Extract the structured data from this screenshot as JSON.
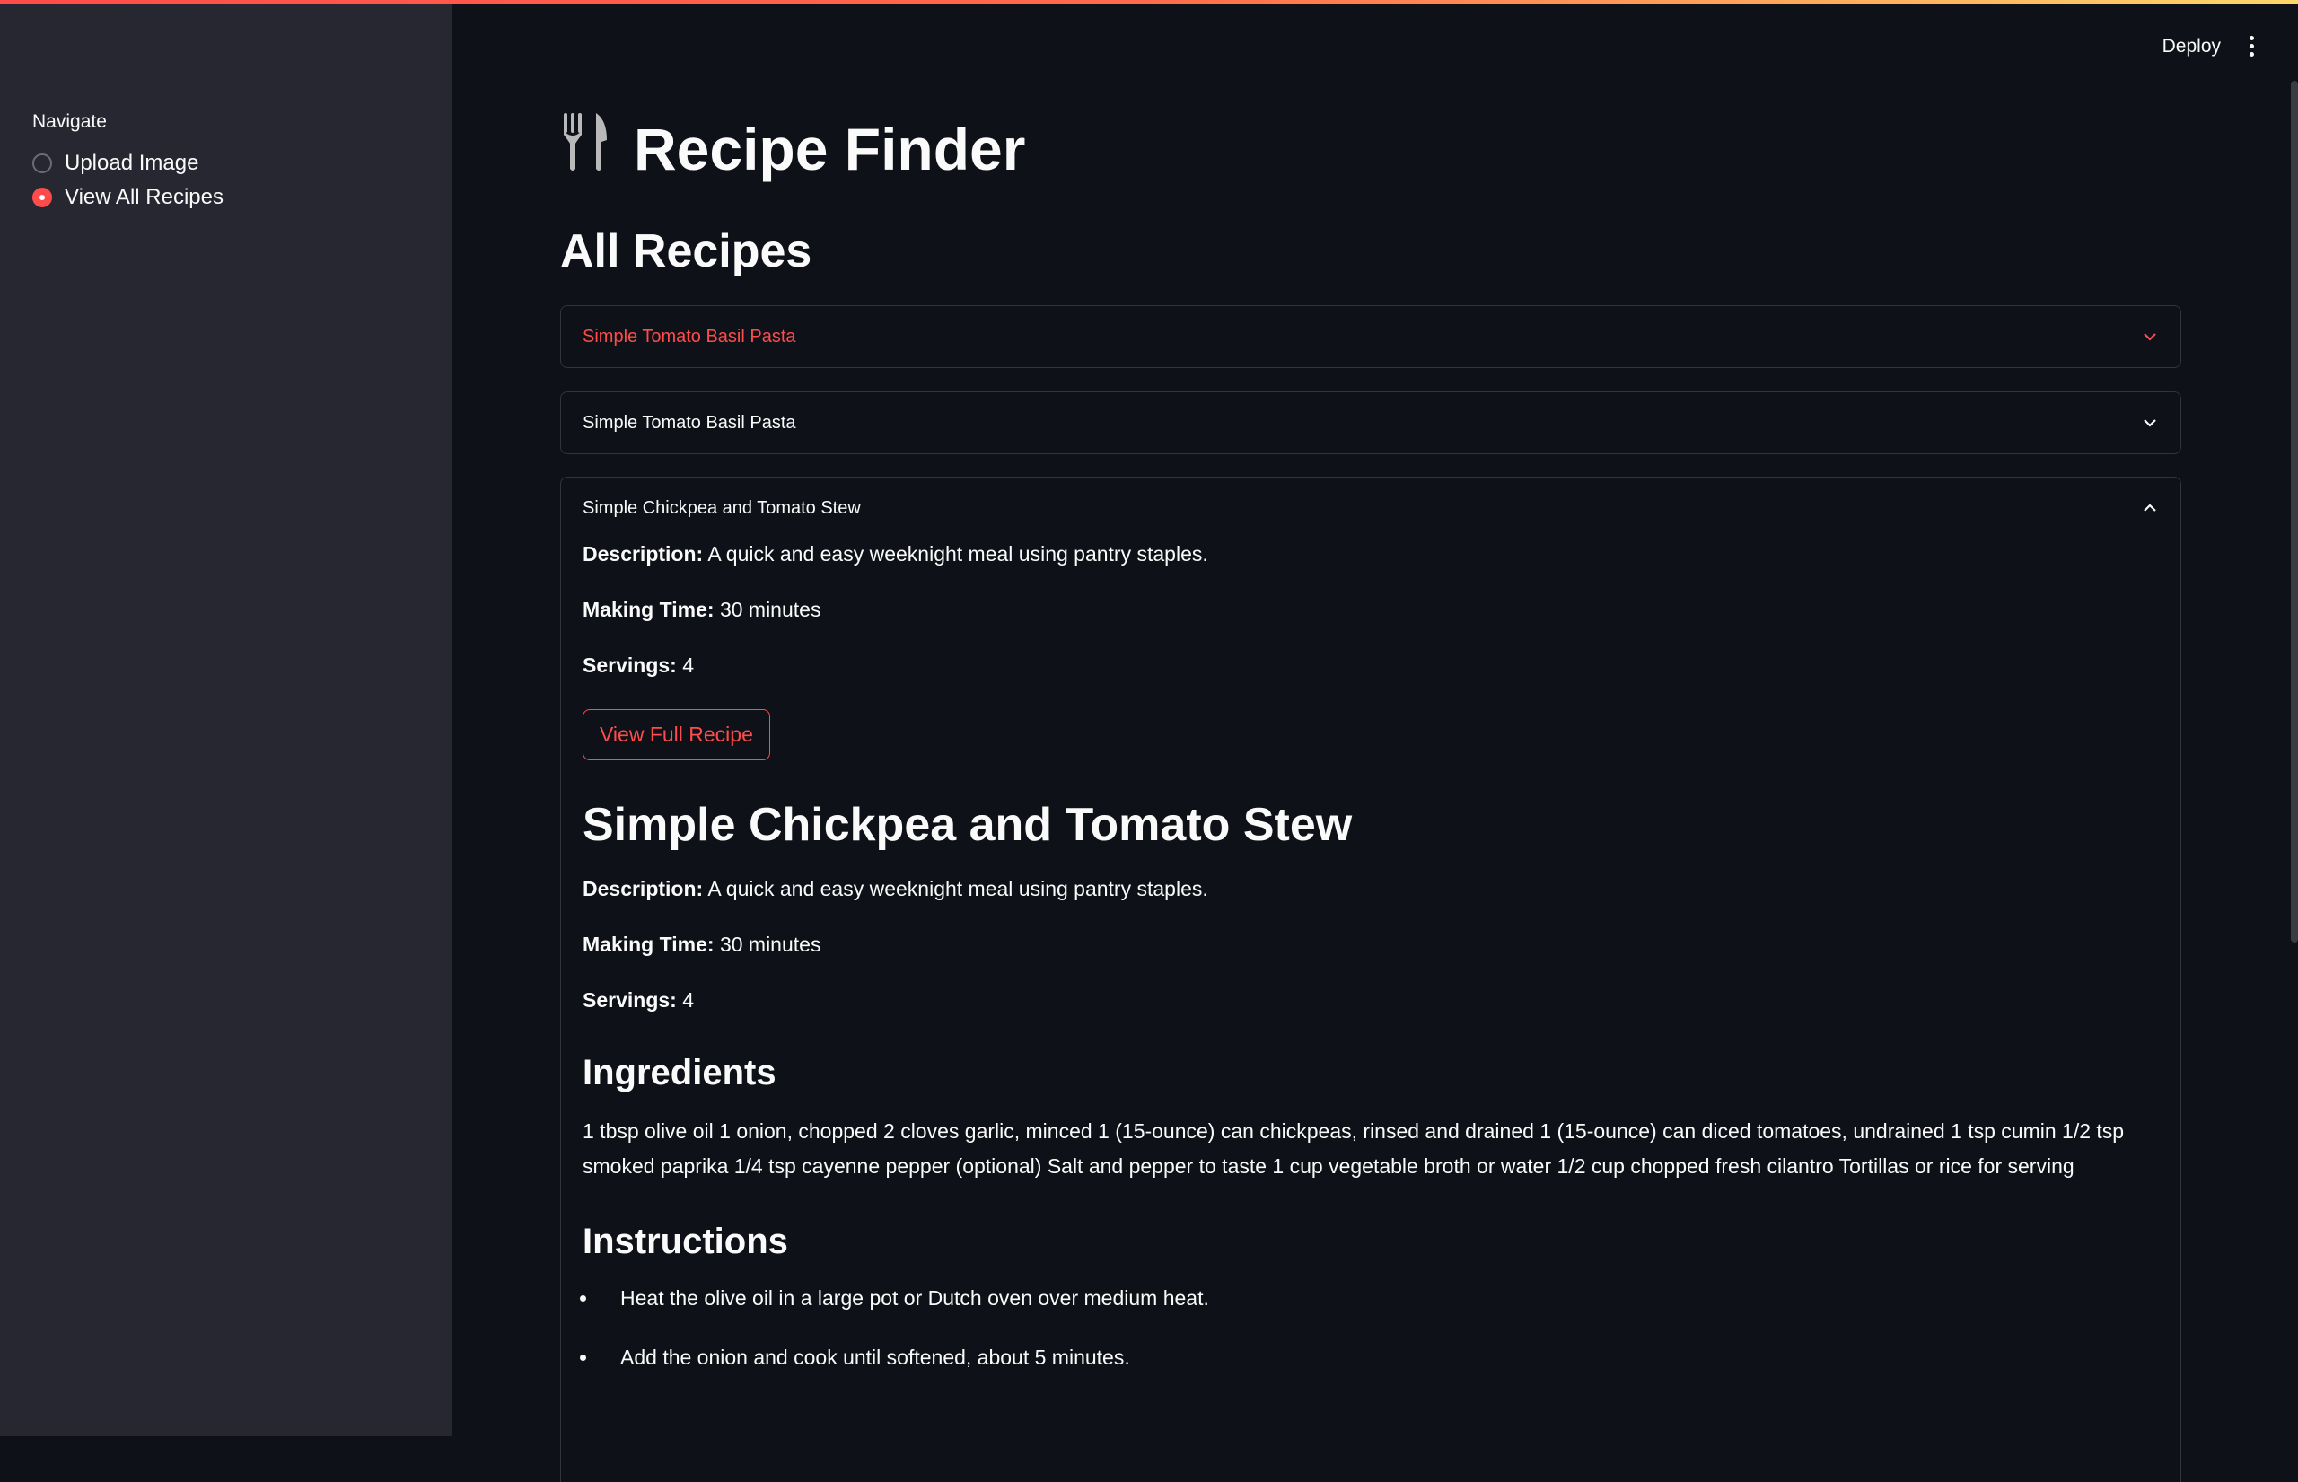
{
  "sidebar": {
    "nav_label": "Navigate",
    "options": [
      {
        "label": "Upload Image",
        "selected": false
      },
      {
        "label": "View All Recipes",
        "selected": true
      }
    ]
  },
  "header": {
    "deploy_label": "Deploy",
    "menu_icon": "more-vert-icon"
  },
  "main": {
    "app_title": "Recipe Finder",
    "title_icon": "utensils-icon",
    "section_title": "All Recipes",
    "expanders": [
      {
        "title": "Simple Tomato Basil Pasta",
        "expanded": false,
        "active": true
      },
      {
        "title": "Simple Tomato Basil Pasta",
        "expanded": false,
        "active": false
      },
      {
        "title": "Simple Chickpea and Tomato Stew",
        "expanded": true,
        "active": false
      }
    ],
    "expanded_recipe": {
      "summary": {
        "description_label": "Description:",
        "description": "A quick and easy weeknight meal using pantry staples.",
        "making_time_label": "Making Time:",
        "making_time": "30 minutes",
        "servings_label": "Servings:",
        "servings": "4"
      },
      "view_full_button": "View Full Recipe",
      "full": {
        "title": "Simple Chickpea and Tomato Stew",
        "description_label": "Description:",
        "description": "A quick and easy weeknight meal using pantry staples.",
        "making_time_label": "Making Time:",
        "making_time": "30 minutes",
        "servings_label": "Servings:",
        "servings": "4",
        "ingredients_heading": "Ingredients",
        "ingredients_text": "1 tbsp olive oil 1 onion, chopped 2 cloves garlic, minced 1 (15-ounce) can chickpeas, rinsed and drained 1 (15-ounce) can diced tomatoes, undrained 1 tsp cumin 1/2 tsp smoked paprika 1/4 tsp cayenne pepper (optional) Salt and pepper to taste 1 cup vegetable broth or water 1/2 cup chopped fresh cilantro Tortillas or rice for serving",
        "instructions_heading": "Instructions",
        "instructions": [
          "Heat the olive oil in a large pot or Dutch oven over medium heat.",
          "Add the onion and cook until softened, about 5 minutes."
        ]
      }
    }
  },
  "colors": {
    "accent": "#ff4b4b",
    "sidebar_bg": "#262730",
    "main_bg": "#0e1117"
  }
}
